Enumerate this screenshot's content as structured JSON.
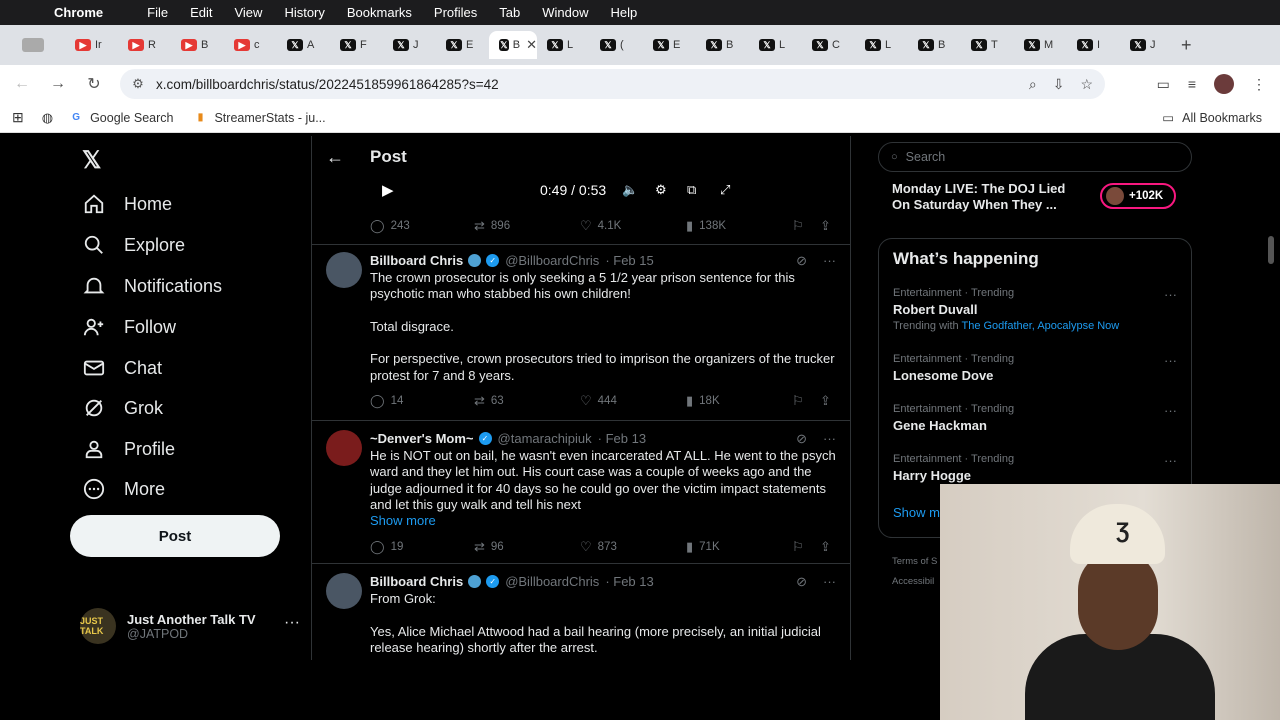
{
  "mac_menu": {
    "app": "Chrome",
    "items": [
      "File",
      "Edit",
      "View",
      "History",
      "Bookmarks",
      "Profiles",
      "Tab",
      "Window",
      "Help"
    ]
  },
  "tabs": [
    {
      "icon": "grey",
      "label": ""
    },
    {
      "icon": "yt",
      "label": "Ir"
    },
    {
      "icon": "yt",
      "label": "R"
    },
    {
      "icon": "yt",
      "label": "B"
    },
    {
      "icon": "yt",
      "label": "c"
    },
    {
      "icon": "x",
      "label": "A"
    },
    {
      "icon": "x",
      "label": "F"
    },
    {
      "icon": "x",
      "label": "J"
    },
    {
      "icon": "x",
      "label": "E"
    },
    {
      "icon": "x",
      "label": "B",
      "active": true
    },
    {
      "icon": "x",
      "label": "L"
    },
    {
      "icon": "x",
      "label": "("
    },
    {
      "icon": "x",
      "label": "E"
    },
    {
      "icon": "x",
      "label": "B"
    },
    {
      "icon": "x",
      "label": "L"
    },
    {
      "icon": "x",
      "label": "C"
    },
    {
      "icon": "x",
      "label": "L"
    },
    {
      "icon": "x",
      "label": "B"
    },
    {
      "icon": "x",
      "label": "T"
    },
    {
      "icon": "x",
      "label": "M"
    },
    {
      "icon": "x",
      "label": "I"
    },
    {
      "icon": "x",
      "label": "J"
    }
  ],
  "toolbar": {
    "url": "x.com/billboardchris/status/2022451859961864285?s=42"
  },
  "bookmarks": {
    "items": [
      "Google Search",
      "StreamerStats - ju..."
    ],
    "all": "All Bookmarks"
  },
  "left_nav": {
    "items": [
      "Home",
      "Explore",
      "Notifications",
      "Follow",
      "Chat",
      "Grok",
      "Profile",
      "More"
    ],
    "post_button": "Post",
    "account_name": "Just Another Talk TV",
    "account_handle": "@JATPOD",
    "account_avatar_text": "JUST TALK"
  },
  "timeline": {
    "header_title": "Post",
    "video": {
      "time": "0:49 / 0:53"
    },
    "top_actions": {
      "replies": "243",
      "reposts": "896",
      "likes": "4.1K",
      "views": "138K"
    },
    "tweets": [
      {
        "name": "Billboard Chris",
        "handle": "@BillboardChris",
        "date": "· Feb 15",
        "text": "The crown prosecutor is only seeking a 5 1/2 year prison sentence for this psychotic man who stabbed his own children!\n\nTotal disgrace.\n\nFor perspective, crown prosecutors tried to imprison the organizers of the trucker protest for 7 and 8 years.",
        "replies": "14",
        "reposts": "63",
        "likes": "444",
        "views": "18K"
      },
      {
        "name": "~Denver's Mom~",
        "handle": "@tamarachipiuk",
        "date": "· Feb 13",
        "text": "He is NOT out on bail, he wasn't even incarcerated AT ALL. He went to the psych ward and they let him out. His court case was a couple of weeks ago and the judge adjourned it for 40 days so he could go over the victim impact statements and let this guy walk and tell his next",
        "show_more": "Show more",
        "replies": "19",
        "reposts": "96",
        "likes": "873",
        "views": "71K"
      },
      {
        "name": "Billboard Chris",
        "handle": "@BillboardChris",
        "date": "· Feb 13",
        "text": "From Grok:\n\nYes, Alice Michael Attwood had a bail hearing (more precisely, an initial judicial release hearing) shortly after the arrest."
      }
    ]
  },
  "right_col": {
    "search_placeholder": "Search",
    "live": {
      "title": "Monday LIVE: The DOJ Lied On Saturday When They ...",
      "count": "+102K"
    },
    "happening_title": "What’s happening",
    "trends": [
      {
        "meta": "Entertainment · Trending",
        "name": "Robert Duvall",
        "sub_prefix": "Trending with ",
        "sub_links": "The Godfather, Apocalypse Now"
      },
      {
        "meta": "Entertainment · Trending",
        "name": "Lonesome Dove"
      },
      {
        "meta": "Entertainment · Trending",
        "name": "Gene Hackman"
      },
      {
        "meta": "Entertainment · Trending",
        "name": "Harry Hogge"
      }
    ],
    "show_more": "Show m",
    "footer1": "Terms of S",
    "footer2": "Accessibil"
  },
  "webcam": {
    "cap_mark": "Ʒ"
  },
  "colors": {
    "accent": "#1d9bf0",
    "live_ring": "#f91880",
    "background": "#000000"
  }
}
